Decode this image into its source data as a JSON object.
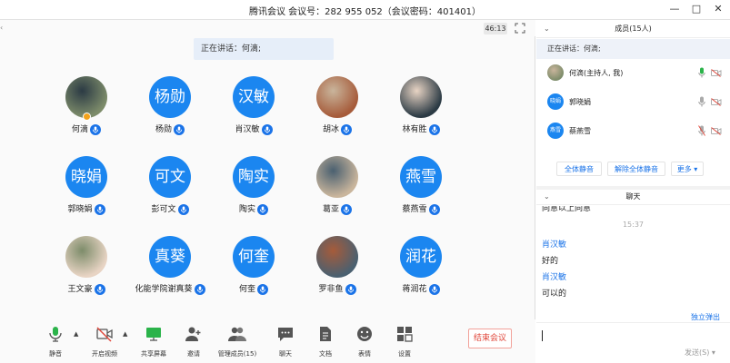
{
  "window": {
    "title": "腾讯会议 会议号：282 955 052（会议密码：401401）",
    "minimize": "—",
    "maximize": "□",
    "close": "✕"
  },
  "main": {
    "timer": "46:13",
    "speaking": "正在讲话：何滴;",
    "participants": [
      {
        "name": "何滴",
        "avatar_text": "",
        "avatar_type": "photo",
        "host": true
      },
      {
        "name": "杨勋",
        "avatar_text": "杨勋",
        "avatar_type": "text"
      },
      {
        "name": "肖汉敏",
        "avatar_text": "汉敏",
        "avatar_type": "text"
      },
      {
        "name": "胡冰",
        "avatar_text": "",
        "avatar_type": "photo"
      },
      {
        "name": "林有胜",
        "avatar_text": "",
        "avatar_type": "photo"
      },
      {
        "name": "郭晓娟",
        "avatar_text": "晓娟",
        "avatar_type": "text"
      },
      {
        "name": "彭可文",
        "avatar_text": "可文",
        "avatar_type": "text"
      },
      {
        "name": "陶实",
        "avatar_text": "陶实",
        "avatar_type": "text"
      },
      {
        "name": "葛亚",
        "avatar_text": "",
        "avatar_type": "photo"
      },
      {
        "name": "蔡燕雪",
        "avatar_text": "燕雪",
        "avatar_type": "text"
      },
      {
        "name": "王文豪",
        "avatar_text": "",
        "avatar_type": "photo"
      },
      {
        "name": "化能学院谢真葵",
        "avatar_text": "真葵",
        "avatar_type": "text"
      },
      {
        "name": "何奎",
        "avatar_text": "何奎",
        "avatar_type": "text"
      },
      {
        "name": "罗非鱼",
        "avatar_text": "",
        "avatar_type": "photo"
      },
      {
        "name": "蒋润花",
        "avatar_text": "润花",
        "avatar_type": "text"
      }
    ]
  },
  "toolbar": {
    "mute": "静音",
    "video": "开启视频",
    "share": "共享屏幕",
    "invite": "邀请",
    "manage": "管理成员(15)",
    "chat": "聊天",
    "docs": "文档",
    "emoji": "表情",
    "settings": "设置",
    "end": "结束会议"
  },
  "members": {
    "header": "成员(15人)",
    "speaking": "正在讲话：何滴;",
    "list": [
      {
        "name": "何滴(主持人, 我)",
        "avatar_text": "",
        "avatar_type": "photo"
      },
      {
        "name": "郭晓娟",
        "avatar_text": "晓娟",
        "avatar_type": "text"
      },
      {
        "name": "蔡燕雪",
        "avatar_text": "燕雪",
        "avatar_type": "text"
      }
    ],
    "mute_all": "全体静音",
    "unmute_all": "解除全体静音",
    "more": "更多 ▾"
  },
  "chat": {
    "header": "聊天",
    "prev_msg": "同意以上同意",
    "time": "15:37",
    "messages": [
      {
        "sender": "肖汉敏",
        "text": "好的"
      },
      {
        "sender": "肖汉敏",
        "text": "可以的"
      }
    ],
    "popout": "独立弹出",
    "send": "发送(S) ▾"
  },
  "colors": {
    "accent": "#1a73e8",
    "avatar_blue": "#1b86f0",
    "end_red": "#e0463a"
  }
}
